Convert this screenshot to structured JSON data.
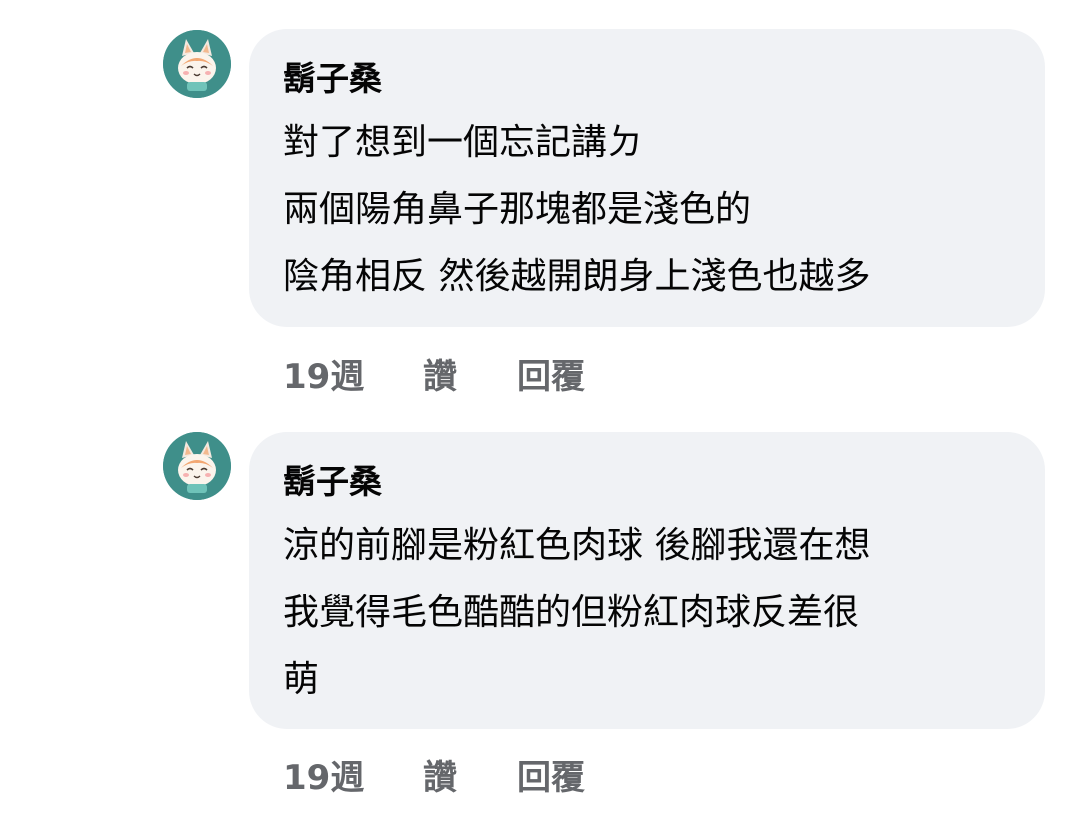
{
  "comments": [
    {
      "author": "鬍子桑",
      "lines": [
        "對了想到一個忘記講ㄉ",
        "兩個陽角鼻子那塊都是淺色的",
        "陰角相反 然後越開朗身上淺色也越多"
      ],
      "time": "19週",
      "like_label": "讚",
      "reply_label": "回覆"
    },
    {
      "author": "鬍子桑",
      "lines": [
        "涼的前腳是粉紅色肉球 後腳我還在想",
        "我覺得毛色酷酷的但粉紅肉球反差很",
        "萌"
      ],
      "time": "19週",
      "like_label": "讚",
      "reply_label": "回覆"
    }
  ],
  "colors": {
    "bubble": "#f0f2f5",
    "text": "#050505",
    "meta": "#65676b",
    "avatar_bg": "#3f8f8a"
  }
}
